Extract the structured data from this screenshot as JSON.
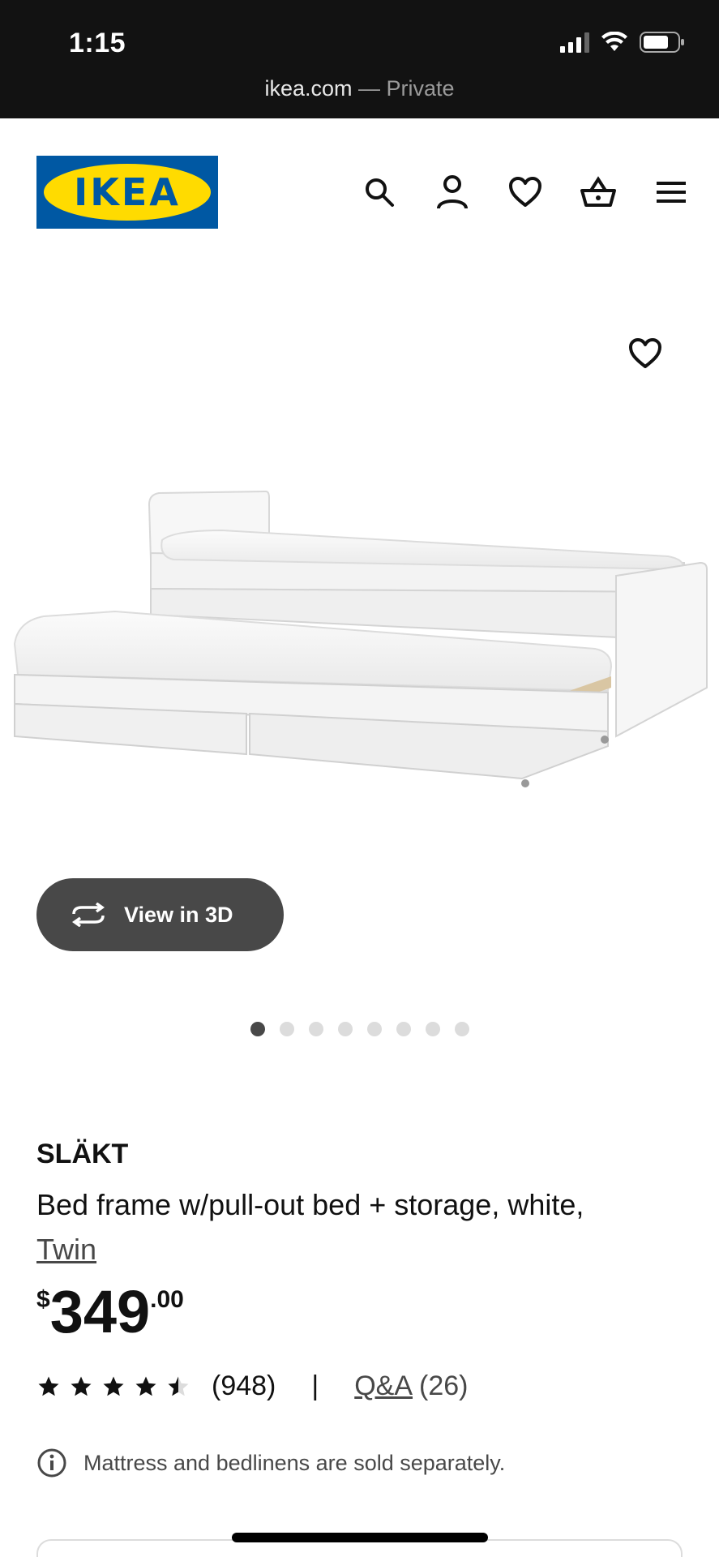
{
  "status_bar": {
    "time": "1:15",
    "url_domain": "ikea.com",
    "url_suffix": " — Private"
  },
  "header": {
    "logo_text": "IKEA",
    "icons": [
      "search-icon",
      "account-icon",
      "heart-icon",
      "basket-icon",
      "menu-icon"
    ]
  },
  "gallery": {
    "view3d_label": "View in 3D",
    "slide_count": 8,
    "active_slide": 1
  },
  "product": {
    "name": "SLÄKT",
    "description": "Bed frame w/pull-out bed + storage, white,",
    "size": "Twin",
    "price_currency": "$",
    "price_whole": "349",
    "price_cents": ".00",
    "rating": 4.5,
    "review_count": "(948)",
    "separator": "|",
    "qa_label": "Q&A",
    "qa_count": "(26)",
    "note": "Mattress and bedlinens are sold separately."
  },
  "colors": {
    "ikea_blue": "#0058a3",
    "ikea_yellow": "#ffdb00",
    "button_dark": "#484848"
  }
}
